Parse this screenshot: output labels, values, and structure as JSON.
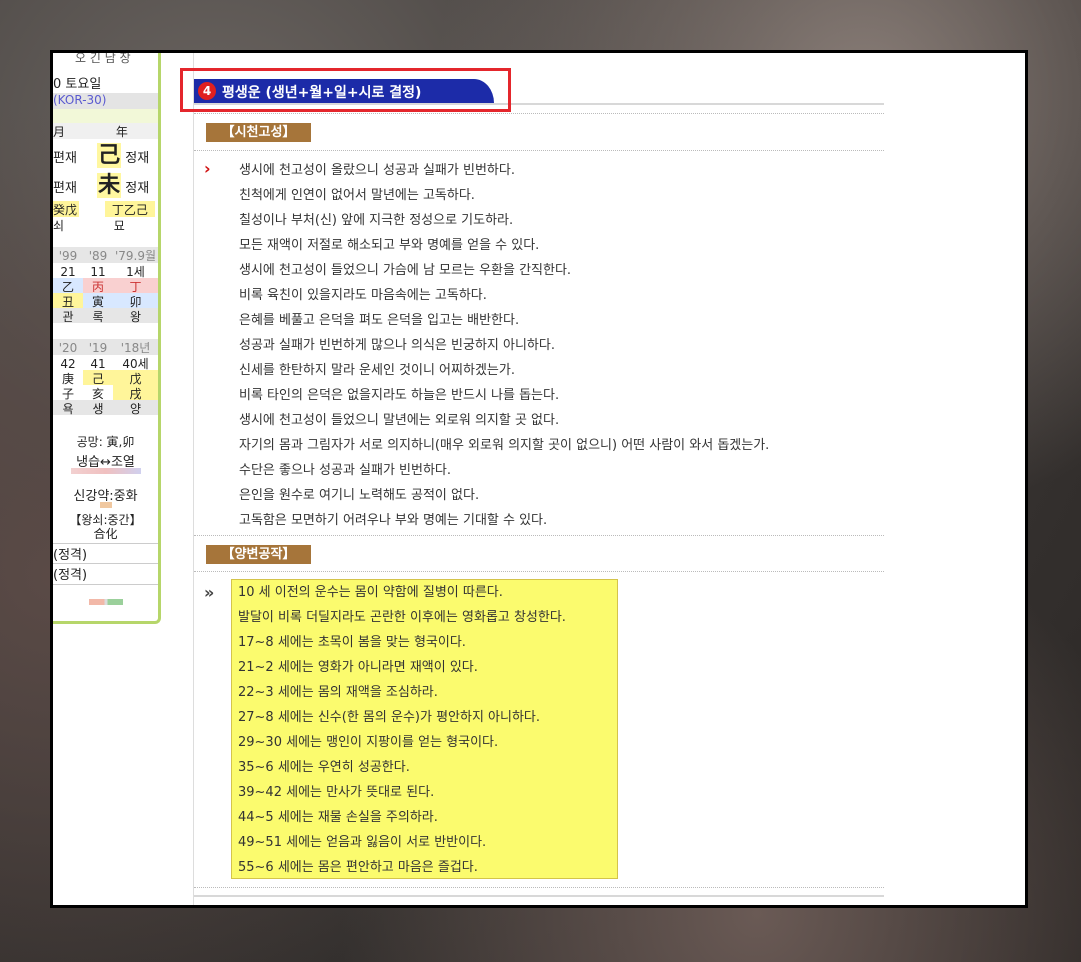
{
  "left_panel": {
    "top_fragment": "오 긴 남 장",
    "date": "0 토요일",
    "kor": "(KOR-30)",
    "pillar_headers": [
      "月",
      "年"
    ],
    "row1": {
      "left": "편재",
      "gan": "己",
      "right": "정재"
    },
    "row2": {
      "left": "편재",
      "gan": "未",
      "right": "정재"
    },
    "row3": {
      "a": "癸戊",
      "b": "丁乙己"
    },
    "row4": {
      "a": "쇠",
      "b": "묘"
    },
    "daeun_years": [
      "'99",
      "'89",
      "'79.9월"
    ],
    "daeun_ages": [
      "21",
      "11",
      "1세"
    ],
    "daeun_gan": [
      "乙",
      "丙",
      "丁"
    ],
    "daeun_ji": [
      "丑",
      "寅",
      "卯"
    ],
    "daeun_stage": [
      "관",
      "록",
      "왕"
    ],
    "seun_years": [
      "'20",
      "'19",
      "'18년"
    ],
    "seun_ages": [
      "42",
      "41",
      "40세"
    ],
    "seun_gan": [
      "庚",
      "己",
      "戊"
    ],
    "seun_ji": [
      "子",
      "亥",
      "戌"
    ],
    "seun_stage": [
      "욕",
      "생",
      "양"
    ],
    "gongmang": "공망: 寅,卯",
    "temp": "냉습↔조열",
    "strength": "신강약:중화",
    "wangsoe": "【왕쇠:중간】",
    "hwa": "合化",
    "jeonggyeok1": "(정격)",
    "jeonggyeok2": "(정격)"
  },
  "section": {
    "number": "4",
    "title": "평생운 (생년+월+일+시로 결정)"
  },
  "sicheon": {
    "label": "【시천고성】",
    "arrow": "›",
    "lines": [
      "생시에 천고성이 올랐으니 성공과 실패가 빈번하다.",
      "친척에게 인연이 없어서 말년에는 고독하다.",
      "칠성이나 부처(신) 앞에 지극한 정성으로 기도하라.",
      "모든 재액이 저절로 해소되고 부와 명예를 얻을 수 있다.",
      "생시에 천고성이 들었으니 가슴에 남 모르는 우환을 간직한다.",
      "비록 육친이 있을지라도 마음속에는 고독하다.",
      "은혜를 베풀고 은덕을 펴도 은덕을 입고는 배반한다.",
      "성공과 실패가 빈번하게 많으나 의식은 빈궁하지 아니하다.",
      "신세를 한탄하지 말라 운세인 것이니 어찌하겠는가.",
      "비록 타인의 은덕은 없을지라도 하늘은 반드시 나를 돕는다.",
      "생시에 천고성이 들었으니 말년에는 외로워 의지할 곳 없다.",
      "자기의 몸과 그림자가 서로 의지하니(매우 외로워 의지할 곳이 없으니) 어떤 사람이 와서 돕겠는가.",
      "수단은 좋으나 성공과 실패가 빈번하다.",
      "은인을 원수로 여기니 노력해도 공적이 없다.",
      "고독함은 모면하기 어려우나 부와 명예는 기대할 수 있다."
    ]
  },
  "yangbyeon": {
    "label": "【양변공작】",
    "arrow": "»",
    "lines": [
      "10 세 이전의 운수는 몸이 약함에 질병이 따른다.",
      "발달이 비록 더딜지라도 곤란한 이후에는 영화롭고 창성한다.",
      "17~8 세에는 초목이 봄을 맞는 형국이다.",
      "21~2 세에는 영화가 아니라면 재액이 있다.",
      "22~3 세에는 몸의 재액을 조심하라.",
      "27~8 세에는 신수(한 몸의 운수)가 평안하지 아니하다.",
      "29~30 세에는 맹인이 지팡이를 얻는 형국이다.",
      "35~6 세에는 우연히 성공한다.",
      "39~42 세에는 만사가 뜻대로 된다.",
      "44~5 세에는 재물 손실을 주의하라.",
      "49~51 세에는 얻음과 잃음이 서로 반반이다.",
      "55~6 세에는 몸은 편안하고 마음은 즐겁다."
    ]
  },
  "colors": {
    "tab_blue": "#1c2ba8",
    "highlight_red": "#e4262c",
    "label_brown": "#a6753a",
    "yellow_box": "#fbfb6e",
    "panel_green": "#b6d66a"
  }
}
